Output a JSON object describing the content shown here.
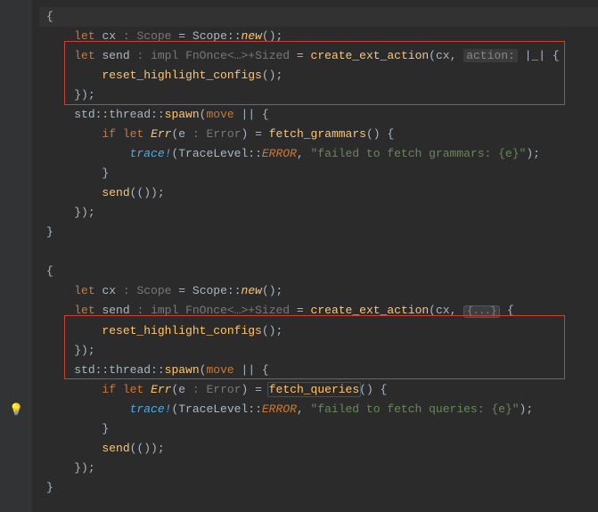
{
  "tok": {
    "let": "let",
    "if": "if",
    "move": "move",
    "Err": "Err",
    "rbrace": "}"
  },
  "hint": {
    "scope": ": Scope",
    "implFnOnce": ": impl FnOnce<…>+Sized",
    "action": "action:",
    "error": ": Error"
  },
  "b1": {
    "l0": "{",
    "cx": "cx",
    "Scope": "Scope",
    "new": "new",
    "newTail": "();",
    "send": "send",
    "create_ext_action": "create_ext_action",
    "cxArg": "cx",
    "closureHead": "|_| {",
    "reset_highlight_configs": "reset_highlight_configs",
    "callTail": "();",
    "closeClosure": "});",
    "std": "std",
    "thread": "thread",
    "spawn": "spawn",
    "moveHead": "|| {",
    "e": "e",
    "fetch_grammars": "fetch_grammars",
    "ifTail": "() {",
    "trace": "trace!",
    "TraceLevel": "TraceLevel",
    "ERROR": "ERROR",
    "str1": "\"failed to fetch grammars: {e}\"",
    "traceTail": ");",
    "sendCall": "send",
    "sendTail": "(());",
    "spawnClose": "});"
  },
  "b2": {
    "l0": "{",
    "cx": "cx",
    "Scope": "Scope",
    "new": "new",
    "newTail": "();",
    "send": "send",
    "create_ext_action": "create_ext_action",
    "cxArg": "cx",
    "fold": "{...}",
    "foldTail": " {",
    "reset_highlight_configs": "reset_highlight_configs",
    "callTail": "();",
    "closeClosure": "});",
    "std": "std",
    "thread": "thread",
    "spawn": "spawn",
    "moveHead": "|| {",
    "e": "e",
    "fetch_queries": "fetch_queries",
    "ifTail": "() {",
    "trace": "trace!",
    "TraceLevel": "TraceLevel",
    "ERROR": "ERROR",
    "str1": "\"failed to fetch queries: {e}\"",
    "traceTail": ");",
    "sendCall": "send",
    "sendTail": "(());",
    "spawnClose": "});"
  }
}
